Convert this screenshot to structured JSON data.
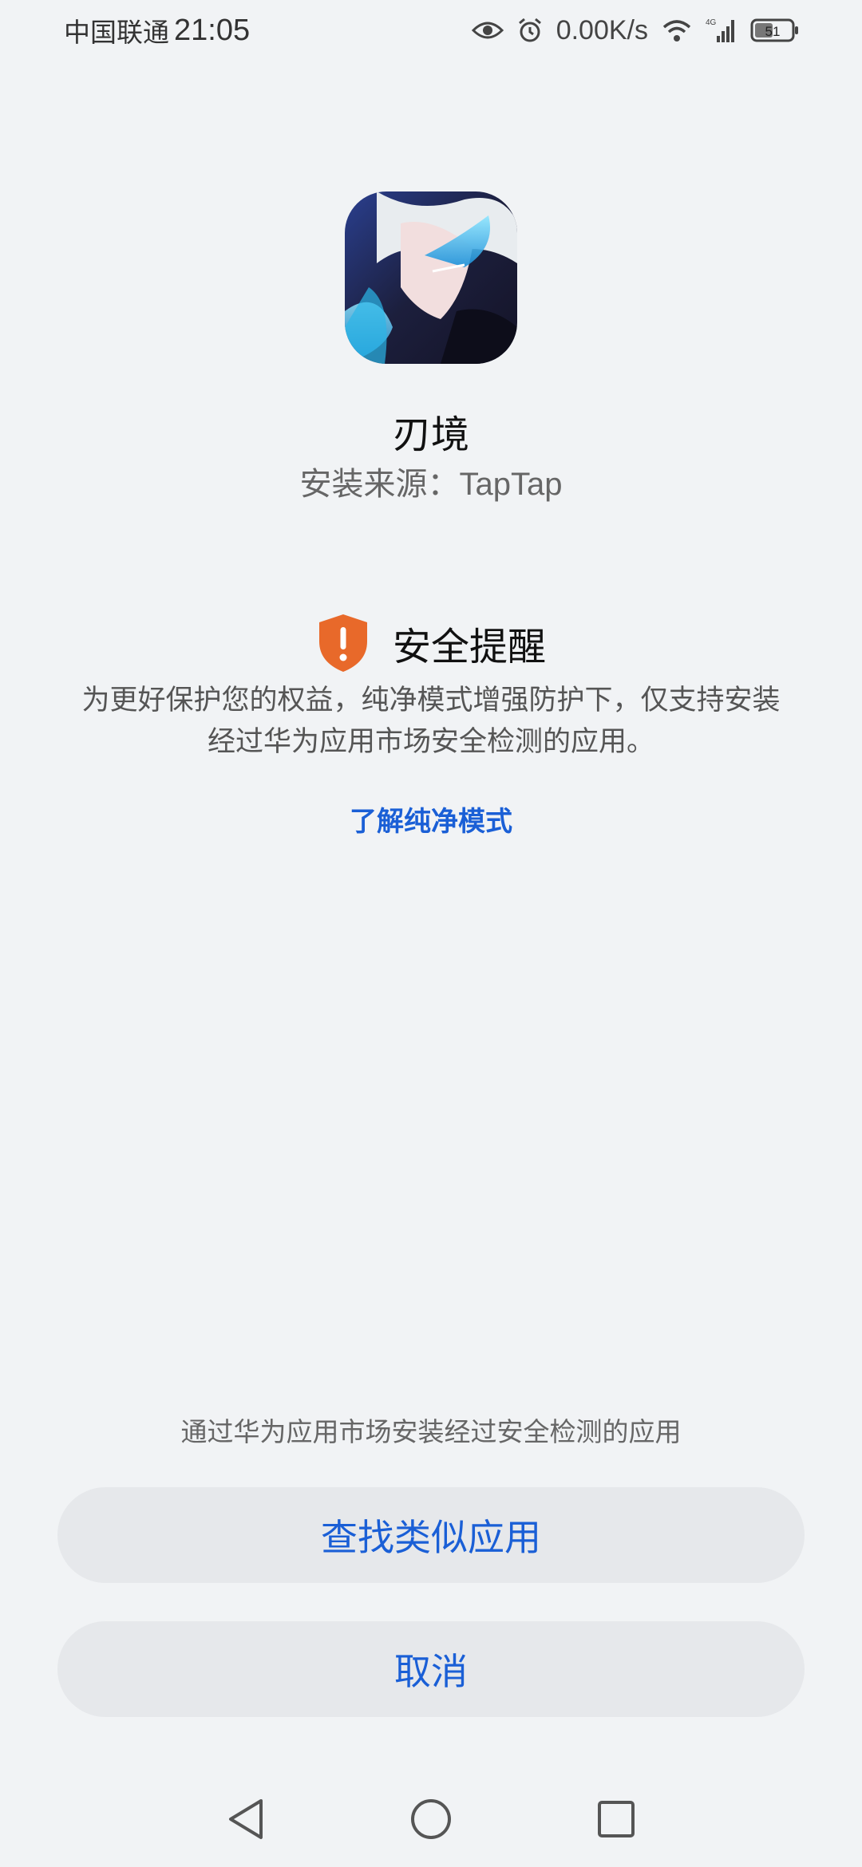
{
  "status_bar": {
    "carrier": "中国联通",
    "time": "21:05",
    "net_speed": "0.00K/s",
    "network_type": "4G",
    "battery": "51",
    "icons": [
      "eye-icon",
      "alarm-icon",
      "wifi-icon",
      "signal-icon",
      "battery-icon"
    ]
  },
  "app": {
    "name": "刃境",
    "source_prefix": "安装来源：",
    "source": "TapTap",
    "icon": "app-icon-illustration"
  },
  "alert": {
    "icon": "shield-warning-icon",
    "title": "安全提醒",
    "message_line1": "为更好保护您的权益，纯净模式增强防护下，仅支持安装",
    "message_line2": "经过华为应用市场安全检测的应用。",
    "learn_more": "了解纯净模式"
  },
  "footer": {
    "hint": "通过华为应用市场安装经过安全检测的应用",
    "find_similar": "查找类似应用",
    "cancel": "取消"
  },
  "colors": {
    "background": "#f1f3f5",
    "accent": "#1a5fd6",
    "warning": "#e8692a",
    "button_bg": "#e6e8eb"
  },
  "nav": {
    "icons": [
      "back-icon",
      "home-icon",
      "recents-icon"
    ]
  }
}
